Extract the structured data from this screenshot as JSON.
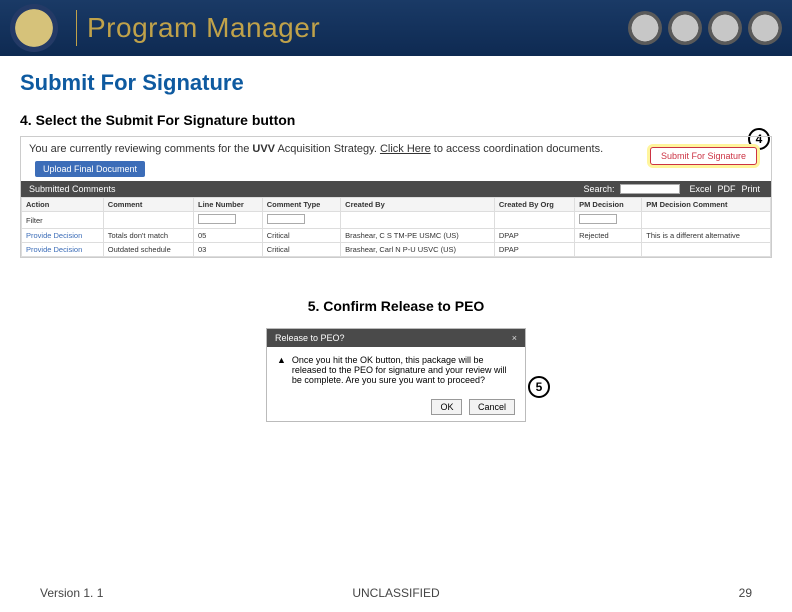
{
  "header": {
    "title": "Program Manager"
  },
  "page_title": "Submit For Signature",
  "step4": {
    "heading": "4.  Select the Submit For Signature button",
    "badge": "4",
    "review_prefix": "You are currently reviewing comments for the ",
    "program": "UVV",
    "doc_type": " Acquisition Strategy. ",
    "click_here": "Click Here",
    "review_suffix": " to access coordination documents.",
    "upload_btn": "Upload Final Document",
    "submit_btn": "Submit For Signature",
    "tab_label": "Submitted Comments",
    "search_label": "Search:",
    "export_labels": [
      "Excel",
      "PDF",
      "Print"
    ],
    "columns": [
      "Action",
      "Comment",
      "Line Number",
      "Comment Type",
      "Created By",
      "Created By Org",
      "PM Decision",
      "PM Decision Comment"
    ],
    "filter_label": "Filter",
    "rows": [
      {
        "action": "Provide Decision",
        "comment": "Totals don't match",
        "line": "05",
        "ctype": "Critical",
        "by": "Brashear, C S TM-PE USMC (US)",
        "org": "DPAP",
        "decision": "Rejected",
        "dcomment": "This is a different alternative"
      },
      {
        "action": "Provide Decision",
        "comment": "Outdated schedule",
        "line": "03",
        "ctype": "Critical",
        "by": "Brashear, Carl N P-U USVC (US)",
        "org": "DPAP",
        "decision": "",
        "dcomment": ""
      }
    ]
  },
  "step5": {
    "heading": "5.  Confirm Release to PEO",
    "badge": "5",
    "dialog_title": "Release to PEO?",
    "close": "×",
    "warn_glyph": "▲",
    "body": "Once you hit the OK button, this package will be released to the PEO for signature and your review will be complete. Are you sure you want to proceed?",
    "ok": "OK",
    "cancel": "Cancel"
  },
  "footer": {
    "version": "Version 1. 1",
    "classification": "UNCLASSIFIED",
    "page": "29"
  }
}
